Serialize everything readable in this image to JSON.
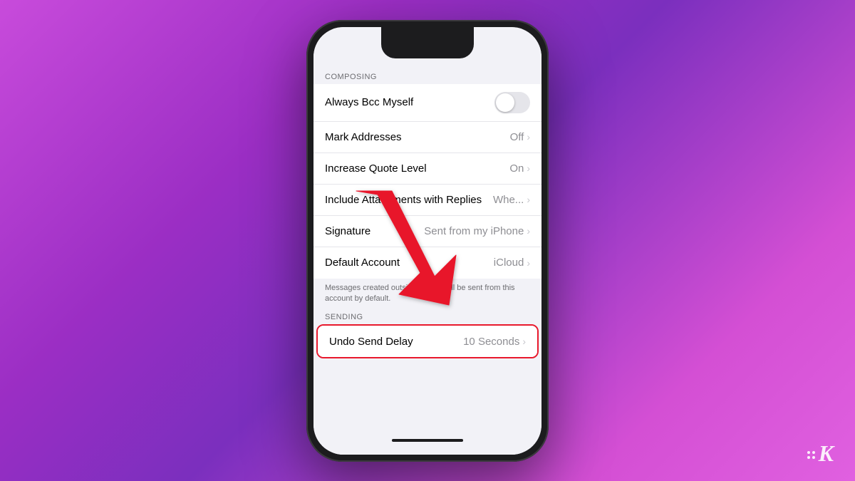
{
  "background": {
    "gradient_start": "#c84bdb",
    "gradient_end": "#7b2fbe"
  },
  "phone": {
    "screen": {
      "composing_header": "COMPOSING",
      "sending_header": "SENDING",
      "rows": [
        {
          "label": "Always Bcc Myself",
          "value": "",
          "type": "toggle",
          "toggle_on": false
        },
        {
          "label": "Mark Addresses",
          "value": "Off",
          "type": "navigation"
        },
        {
          "label": "Increase Quote Level",
          "value": "On",
          "type": "navigation"
        },
        {
          "label": "Include Attachments with Replies",
          "value": "Whe...",
          "type": "navigation"
        },
        {
          "label": "Signature",
          "value": "Sent from my iPhone",
          "type": "navigation"
        },
        {
          "label": "Default Account",
          "value": "iCloud",
          "type": "navigation"
        }
      ],
      "note": "Messages created outside of Mail will be sent from this account by default.",
      "sending_rows": [
        {
          "label": "Undo Send Delay",
          "value": "10 Seconds",
          "type": "navigation",
          "highlighted": true
        }
      ]
    }
  },
  "watermark": {
    "letter": "K"
  }
}
